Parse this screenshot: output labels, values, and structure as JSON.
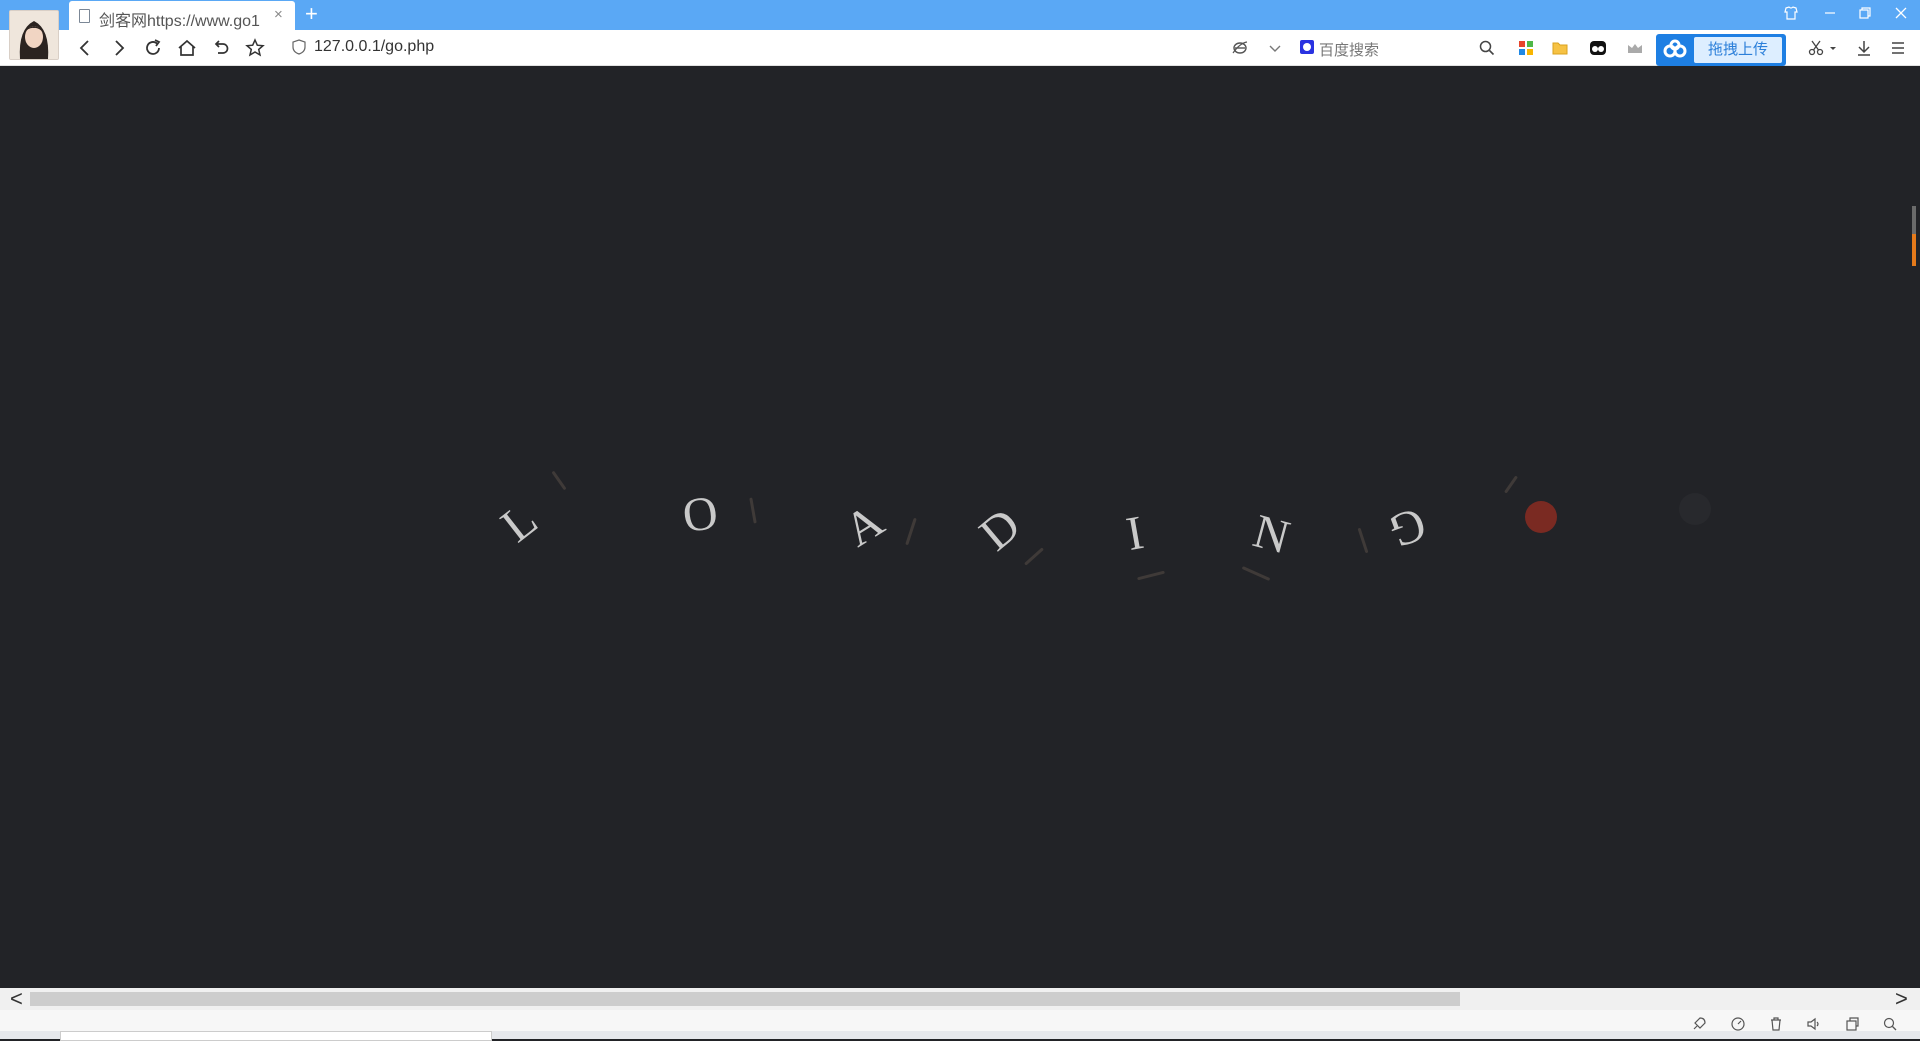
{
  "browser": {
    "tab": {
      "title": "剑客网https://www.go1",
      "close_glyph": "×"
    },
    "new_tab_glyph": "+",
    "window_controls": [
      "shirt-icon",
      "minimize-icon",
      "restore-icon",
      "close-icon"
    ],
    "address": {
      "url": "127.0.0.1/go.php"
    },
    "search": {
      "placeholder": "百度搜索"
    },
    "upload_widget": {
      "label": "拖拽上传"
    }
  },
  "page": {
    "loading_letters": [
      "L",
      "O",
      "A",
      "D",
      "I",
      "N",
      "G"
    ],
    "background_color": "#222327",
    "letter_color": "#c9c9c9",
    "dot_color": "#7a2a22"
  },
  "scrollbar": {
    "left_arrow": "<",
    "right_arrow": ">"
  }
}
